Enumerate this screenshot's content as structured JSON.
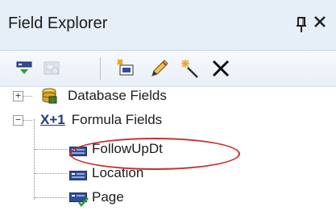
{
  "panel": {
    "title": "Field Explorer"
  },
  "header_buttons": {
    "pin_icon": "pin-icon",
    "close_icon": "close-icon",
    "close_glyph": "x"
  },
  "toolbar": {
    "buttons": [
      {
        "icon": "insert-field-icon",
        "enabled": true
      },
      {
        "icon": "browse-field-icon",
        "enabled": false
      },
      {
        "icon": "new-field-icon",
        "enabled": true
      },
      {
        "icon": "edit-pencil-icon",
        "enabled": true
      },
      {
        "icon": "wand-icon",
        "enabled": true
      },
      {
        "icon": "delete-icon",
        "enabled": true
      }
    ]
  },
  "tree": {
    "database_fields": {
      "label": "Database Fields",
      "expander": "+",
      "icon": "database-icon"
    },
    "formula_fields": {
      "label": "Formula Fields",
      "expander": "−",
      "icon": "formula-icon",
      "icon_text": "X+1"
    },
    "formula_children": [
      {
        "label": "FollowUpDt",
        "icon": "field-icon",
        "highlighted": true
      },
      {
        "label": "Location",
        "icon": "field-icon"
      },
      {
        "label": "Page",
        "icon": "field-check-icon"
      }
    ]
  },
  "colors": {
    "header_bg": "#e6eef7",
    "highlight_oval": "#c4312c",
    "accent_blue": "#1f3c86"
  }
}
